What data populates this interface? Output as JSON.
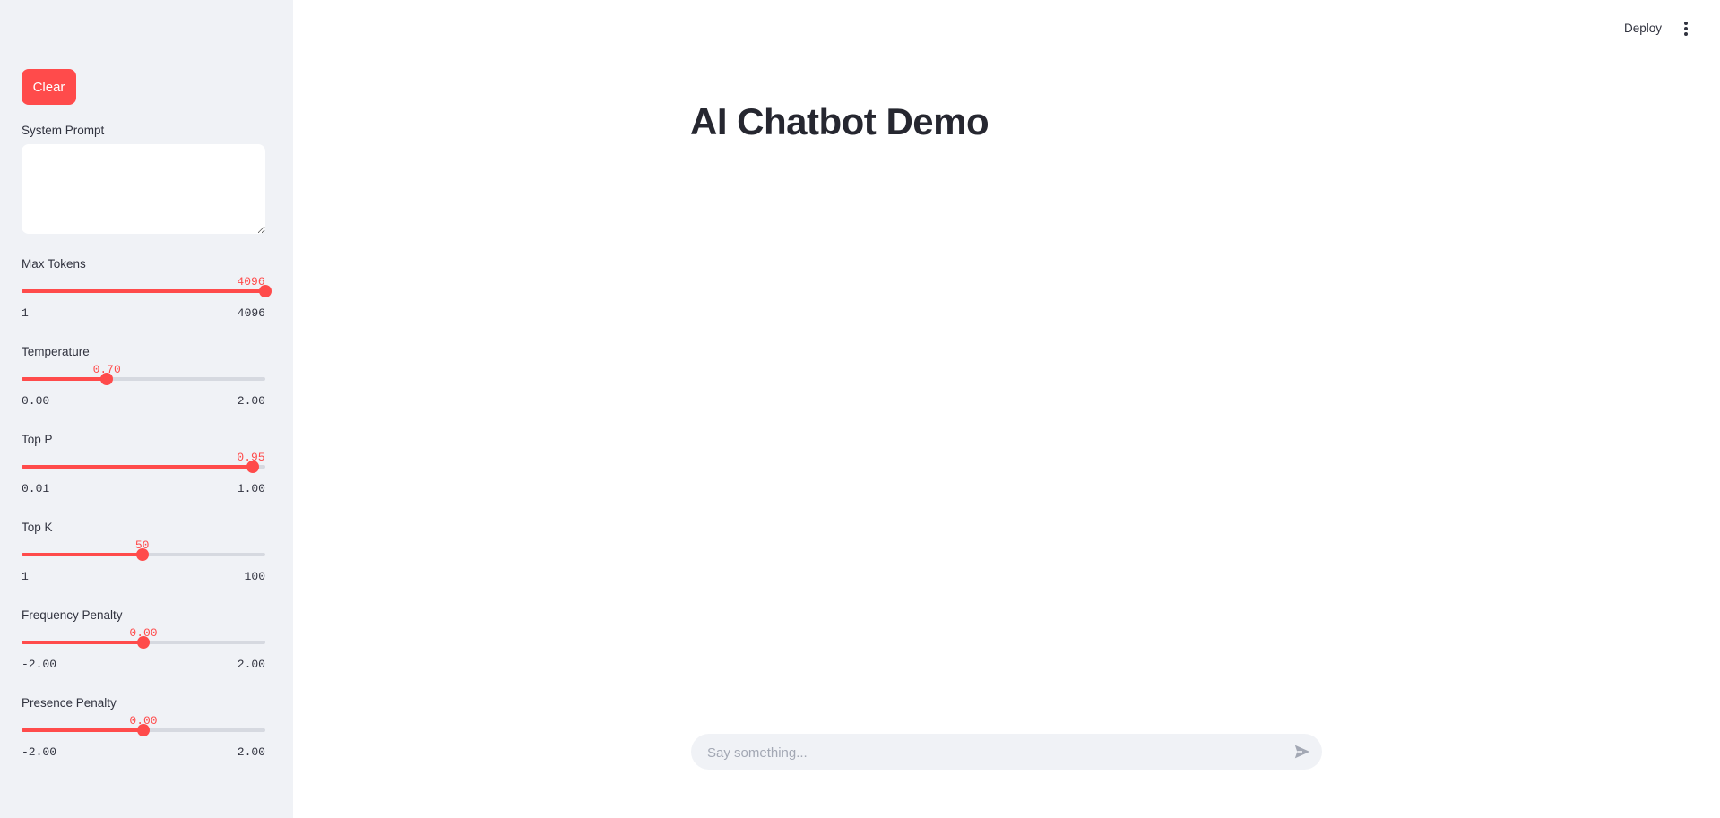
{
  "sidebar": {
    "clear_label": "Clear",
    "system_prompt_label": "System Prompt",
    "system_prompt_value": "",
    "sliders": [
      {
        "id": "max-tokens",
        "label": "Max Tokens",
        "value": "4096",
        "min": "1",
        "max": "4096",
        "fraction": 1.0
      },
      {
        "id": "temperature",
        "label": "Temperature",
        "value": "0.70",
        "min": "0.00",
        "max": "2.00",
        "fraction": 0.35
      },
      {
        "id": "top-p",
        "label": "Top P",
        "value": "0.95",
        "min": "0.01",
        "max": "1.00",
        "fraction": 0.9495
      },
      {
        "id": "top-k",
        "label": "Top K",
        "value": "50",
        "min": "1",
        "max": "100",
        "fraction": 0.495
      },
      {
        "id": "frequency-penalty",
        "label": "Frequency Penalty",
        "value": "0.00",
        "min": "-2.00",
        "max": "2.00",
        "fraction": 0.5
      },
      {
        "id": "presence-penalty",
        "label": "Presence Penalty",
        "value": "0.00",
        "min": "-2.00",
        "max": "2.00",
        "fraction": 0.5
      }
    ]
  },
  "header": {
    "deploy_label": "Deploy",
    "menu_icon": "kebab-menu-icon"
  },
  "main": {
    "title": "AI Chatbot Demo",
    "chat_placeholder": "Say something...",
    "send_icon": "send-icon"
  },
  "colors": {
    "accent": "#ff4b4b",
    "sidebar_bg": "#f0f2f6",
    "text": "#31333f"
  }
}
